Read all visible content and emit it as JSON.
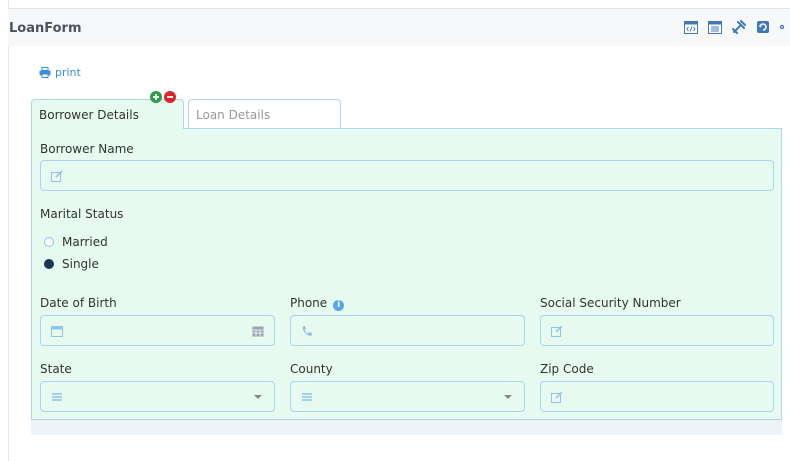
{
  "window": {
    "title": "LoanForm"
  },
  "toolbar": {
    "icons": [
      "code-view-icon",
      "form-view-icon",
      "tools-icon",
      "refresh-icon",
      "settings-icon"
    ]
  },
  "print": {
    "label": "print"
  },
  "tabs": [
    {
      "label": "Borrower Details",
      "active": true
    },
    {
      "label": "Loan Details",
      "active": false
    }
  ],
  "form": {
    "borrower_name": {
      "label": "Borrower Name",
      "value": ""
    },
    "marital_status": {
      "label": "Marital Status",
      "options": [
        "Married",
        "Single"
      ],
      "selected": "Single"
    },
    "date_of_birth": {
      "label": "Date of Birth",
      "value": ""
    },
    "phone": {
      "label": "Phone",
      "value": ""
    },
    "ssn": {
      "label": "Social Security Number",
      "value": ""
    },
    "state": {
      "label": "State",
      "value": ""
    },
    "county": {
      "label": "County",
      "value": ""
    },
    "zip_code": {
      "label": "Zip Code",
      "value": ""
    }
  },
  "colors": {
    "panel_bg": "#e6faef",
    "input_border": "#a9d2f5",
    "accent": "#3a8fd9",
    "radio_selected": "#1b3554",
    "add_button": "#2e9c4b",
    "remove_button": "#d9262b"
  }
}
